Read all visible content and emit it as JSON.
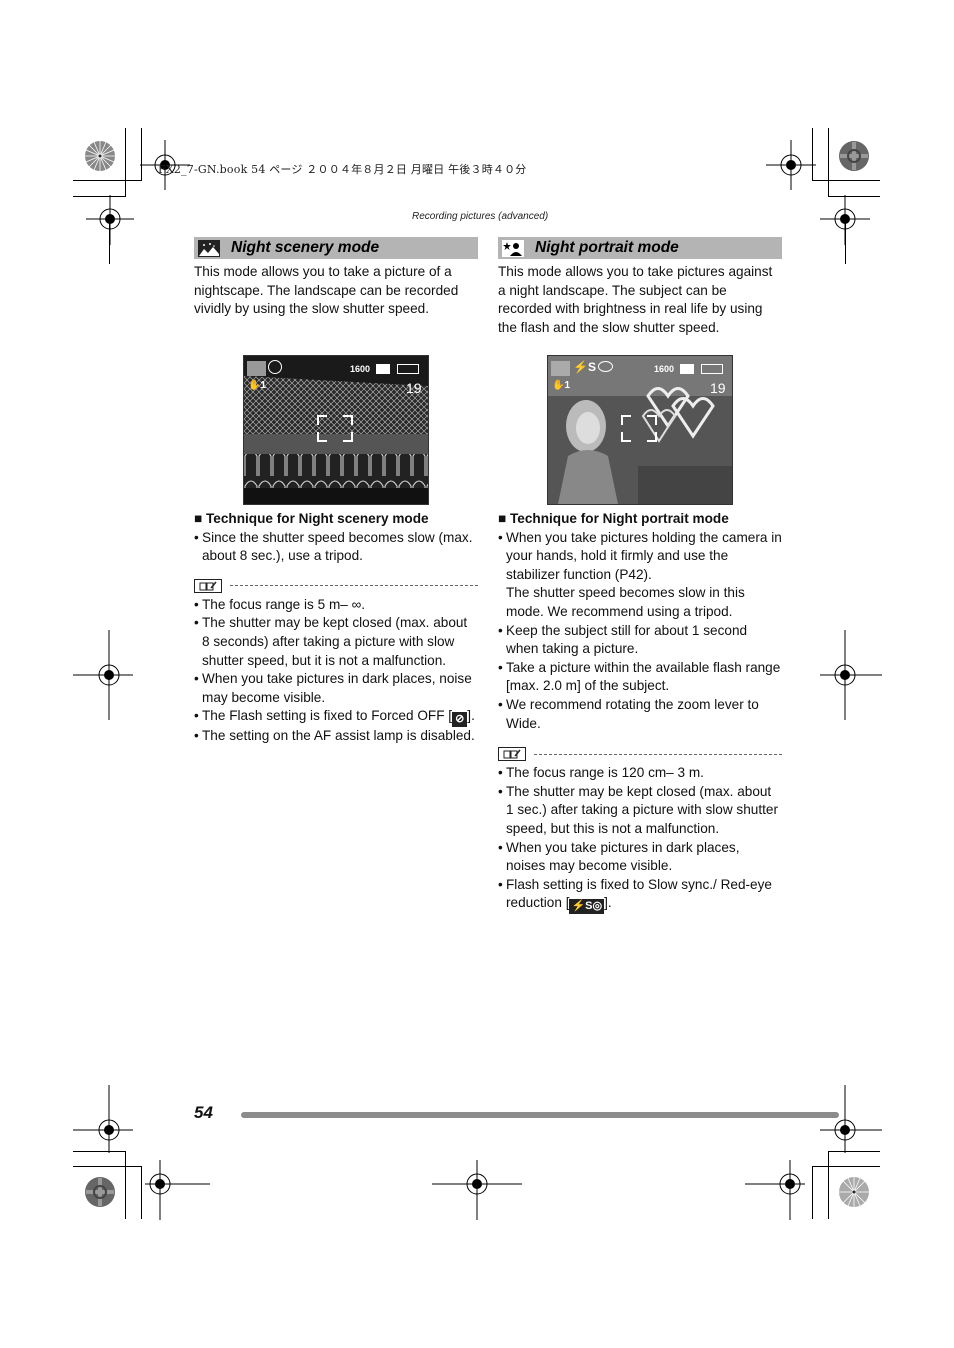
{
  "file_header": "FX2_7-GN.book  54 ページ  ２００４年８月２日  月曜日  午後３時４０分",
  "running_head": "Recording pictures (advanced)",
  "page_number": "54",
  "left": {
    "title": "Night scenery mode",
    "mode_icon": "night-scenery-icon",
    "intro": "This mode allows you to take a picture of a nightscape. The landscape can be recorded vividly by using the slow shutter speed.",
    "screen": {
      "iso": "1600",
      "shots_remaining": "19",
      "stabilizer_mode": "1",
      "icons": [
        "night-scenery-icon",
        "flash-off-icon",
        "stabilizer-icon",
        "picture-size-icon",
        "battery-icon"
      ]
    },
    "technique_title": "Technique for Night scenery mode",
    "technique_bullets": [
      "Since the shutter speed becomes slow (max. about 8 sec.), use a tripod."
    ],
    "notes": [
      "The focus range is 5 m– ∞.",
      "The shutter may be kept closed (max. about 8 seconds) after taking a picture with slow shutter speed, but it is not a malfunction.",
      "When you take pictures in dark places, noise may become visible.",
      "The Flash setting is fixed to Forced OFF",
      "The setting on the AF assist lamp is disabled."
    ],
    "flash_off_bracket_open": "[",
    "flash_off_bracket_close": "]."
  },
  "right": {
    "title": "Night portrait mode",
    "mode_icon": "night-portrait-icon",
    "intro": "This mode allows you to take pictures against a night landscape. The subject can be recorded with brightness in real life by using the flash and the slow shutter speed.",
    "screen": {
      "iso": "1600",
      "shots_remaining": "19",
      "stabilizer_mode": "1",
      "flash_label": "⚡S",
      "icons": [
        "night-portrait-icon",
        "slow-sync-redeye-icon",
        "stabilizer-icon",
        "picture-size-icon",
        "battery-icon"
      ]
    },
    "technique_title": "Technique for Night portrait mode",
    "technique_bullets": [
      "When you take pictures holding the camera in your hands, hold it firmly and use the stabilizer function (P42).",
      "Keep the subject still for about 1 second when taking a picture.",
      "Take a picture within the available flash range [max. 2.0 m] of the subject.",
      "We recommend rotating the zoom lever to Wide."
    ],
    "technique_continuation": "The shutter speed becomes slow in this mode. We recommend using a tripod.",
    "notes": [
      "The focus range is 120 cm– 3 m.",
      "The shutter may be kept closed (max. about 1 sec.) after taking a picture with slow shutter speed, but this is not a malfunction.",
      "When you take pictures in dark places, noises may become visible.",
      "Flash setting is fixed to Slow sync./ Red-eye reduction"
    ],
    "inline_flash_label": "⚡S◎",
    "bracket_open": "[",
    "bracket_close": "]."
  },
  "bullet_char": "•",
  "square_char": "■"
}
